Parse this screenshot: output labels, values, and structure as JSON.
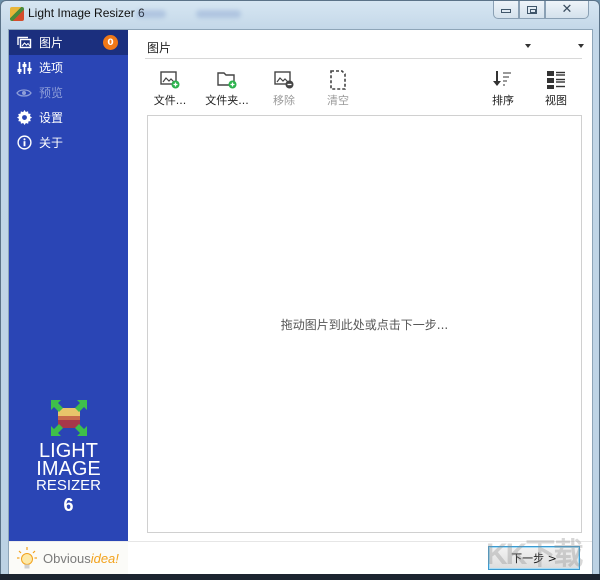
{
  "window": {
    "title": "Light Image Resizer 6",
    "controls": {
      "minimize": "minimize",
      "maximize": "maximize",
      "close": "close"
    }
  },
  "sidebar": {
    "items": [
      {
        "label": "图片",
        "icon": "images-icon",
        "badge": "0",
        "active": true,
        "enabled": true
      },
      {
        "label": "选项",
        "icon": "sliders-icon",
        "active": false,
        "enabled": true
      },
      {
        "label": "预览",
        "icon": "eye-icon",
        "active": false,
        "enabled": false
      },
      {
        "label": "设置",
        "icon": "gear-icon",
        "active": false,
        "enabled": true
      },
      {
        "label": "关于",
        "icon": "info-icon",
        "active": false,
        "enabled": true
      }
    ],
    "brand": {
      "line1": "LIGHT",
      "line2": "IMAGE",
      "line3": "RESIZER",
      "version": "6"
    },
    "vendor": {
      "name_main": "Obvious",
      "name_accent": "idea!"
    }
  },
  "main": {
    "section_title": "图片",
    "toolbar": [
      {
        "label": "文件...",
        "icon": "add-image-icon",
        "enabled": true
      },
      {
        "label": "文件夹...",
        "icon": "add-folder-icon",
        "enabled": true
      },
      {
        "label": "移除",
        "icon": "remove-image-icon",
        "enabled": false
      },
      {
        "label": "清空",
        "icon": "clear-icon",
        "enabled": false
      }
    ],
    "sort": {
      "label": "排序",
      "icon": "sort-icon"
    },
    "view": {
      "label": "视图",
      "icon": "view-list-icon"
    },
    "dropzone_hint": "拖动图片到此处或点击下一步...",
    "next_button": "下一步 >"
  },
  "colors": {
    "sidebar_bg": "#2a45b5",
    "sidebar_active": "#1b2f7e",
    "badge": "#f07818",
    "add_green": "#2bb24c",
    "vendor_accent": "#f2a21c"
  },
  "watermark": "KK下载"
}
